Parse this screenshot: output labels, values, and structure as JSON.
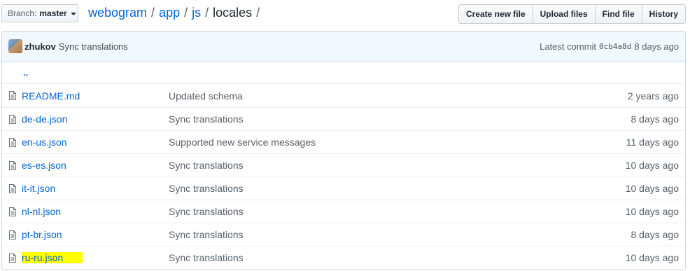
{
  "branch": {
    "prefix": "Branch:",
    "name": "master"
  },
  "breadcrumb": {
    "repo": "webogram",
    "parts": [
      "app",
      "js"
    ],
    "current": "locales",
    "separator": "/"
  },
  "actions": {
    "create": "Create new file",
    "upload": "Upload files",
    "find": "Find file",
    "history": "History"
  },
  "commit": {
    "author": "zhukov",
    "message": "Sync translations",
    "prefix": "Latest commit",
    "sha": "0cb4a8d",
    "age": "8 days ago"
  },
  "parent": {
    "label": ".."
  },
  "files": [
    {
      "name": "README.md",
      "message": "Updated schema",
      "age": "2 years ago"
    },
    {
      "name": "de-de.json",
      "message": "Sync translations",
      "age": "8 days ago"
    },
    {
      "name": "en-us.json",
      "message": "Supported new service messages",
      "age": "11 days ago"
    },
    {
      "name": "es-es.json",
      "message": "Sync translations",
      "age": "10 days ago"
    },
    {
      "name": "it-it.json",
      "message": "Sync translations",
      "age": "10 days ago"
    },
    {
      "name": "nl-nl.json",
      "message": "Sync translations",
      "age": "10 days ago"
    },
    {
      "name": "pt-br.json",
      "message": "Sync translations",
      "age": "8 days ago"
    },
    {
      "name": "ru-ru.json",
      "message": "Sync translations",
      "age": "10 days ago",
      "highlight": "#ffff00"
    }
  ],
  "colors": {
    "link": "#0366d6",
    "highlight": "#ffff00",
    "commit_bg": "#f1f8ff"
  }
}
